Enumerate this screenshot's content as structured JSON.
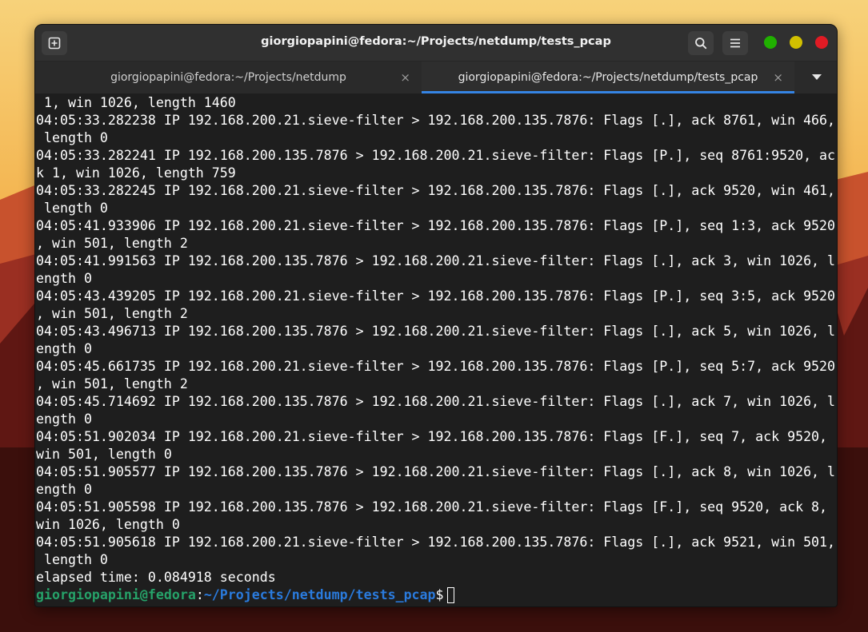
{
  "window": {
    "title": "giorgiopapini@fedora:~/Projects/netdump/tests_pcap"
  },
  "headerbar": {
    "new_tab_icon": "new-tab-icon",
    "search_icon": "search-icon",
    "menu_icon": "hamburger-menu-icon",
    "controls": {
      "minimize_color": "#20b000",
      "maximize_color": "#d2c000",
      "close_color": "#e01b24"
    }
  },
  "tabs": [
    {
      "label": "giorgiopapini@fedora:~/Projects/netdump",
      "close": "×",
      "active": false
    },
    {
      "label": "giorgiopapini@fedora:~/Projects/netdump/tests_pcap",
      "close": "×",
      "active": true
    }
  ],
  "terminal": {
    "lines": [
      " 1, win 1026, length 1460",
      "04:05:33.282238 IP 192.168.200.21.sieve-filter > 192.168.200.135.7876: Flags [.], ack 8761, win 466,",
      " length 0",
      "04:05:33.282241 IP 192.168.200.135.7876 > 192.168.200.21.sieve-filter: Flags [P.], seq 8761:9520, ac",
      "k 1, win 1026, length 759",
      "04:05:33.282245 IP 192.168.200.21.sieve-filter > 192.168.200.135.7876: Flags [.], ack 9520, win 461,",
      " length 0",
      "04:05:41.933906 IP 192.168.200.21.sieve-filter > 192.168.200.135.7876: Flags [P.], seq 1:3, ack 9520",
      ", win 501, length 2",
      "04:05:41.991563 IP 192.168.200.135.7876 > 192.168.200.21.sieve-filter: Flags [.], ack 3, win 1026, l",
      "ength 0",
      "04:05:43.439205 IP 192.168.200.21.sieve-filter > 192.168.200.135.7876: Flags [P.], seq 3:5, ack 9520",
      ", win 501, length 2",
      "04:05:43.496713 IP 192.168.200.135.7876 > 192.168.200.21.sieve-filter: Flags [.], ack 5, win 1026, l",
      "ength 0",
      "04:05:45.661735 IP 192.168.200.21.sieve-filter > 192.168.200.135.7876: Flags [P.], seq 5:7, ack 9520",
      ", win 501, length 2",
      "04:05:45.714692 IP 192.168.200.135.7876 > 192.168.200.21.sieve-filter: Flags [.], ack 7, win 1026, l",
      "ength 0",
      "04:05:51.902034 IP 192.168.200.21.sieve-filter > 192.168.200.135.7876: Flags [F.], seq 7, ack 9520,",
      "win 501, length 0",
      "04:05:51.905577 IP 192.168.200.135.7876 > 192.168.200.21.sieve-filter: Flags [.], ack 8, win 1026, l",
      "ength 0",
      "04:05:51.905598 IP 192.168.200.135.7876 > 192.168.200.21.sieve-filter: Flags [F.], seq 9520, ack 8,",
      "win 1026, length 0",
      "04:05:51.905618 IP 192.168.200.21.sieve-filter > 192.168.200.135.7876: Flags [.], ack 9521, win 501,",
      " length 0",
      "elapsed time: 0.084918 seconds"
    ],
    "prompt": {
      "user_host": "giorgiopapini@fedora",
      "separator": ":",
      "path": "~/Projects/netdump/tests_pcap",
      "symbol": "$"
    }
  }
}
